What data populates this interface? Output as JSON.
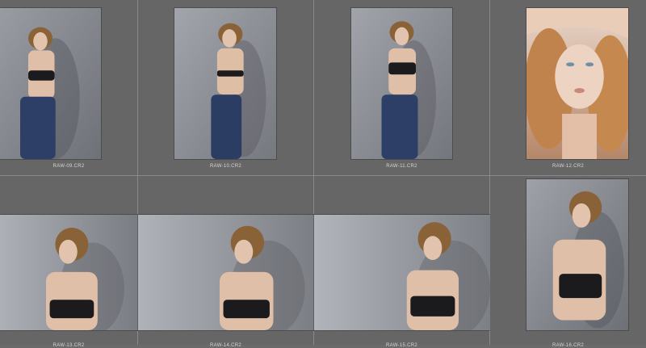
{
  "grid": {
    "cells": [
      {
        "filename": "RAW-09.CR2"
      },
      {
        "filename": "RAW-10.CR2"
      },
      {
        "filename": "RAW-11.CR2"
      },
      {
        "filename": "RAW-12.CR2"
      },
      {
        "filename": "RAW-13.CR2"
      },
      {
        "filename": "RAW-14.CR2"
      },
      {
        "filename": "RAW-15.CR2"
      },
      {
        "filename": "RAW-16.CR2"
      }
    ]
  },
  "colors": {
    "panel_bg": "#666666",
    "cell_divider": "#8a8a8a",
    "filename_text": "#d6d6d6"
  }
}
